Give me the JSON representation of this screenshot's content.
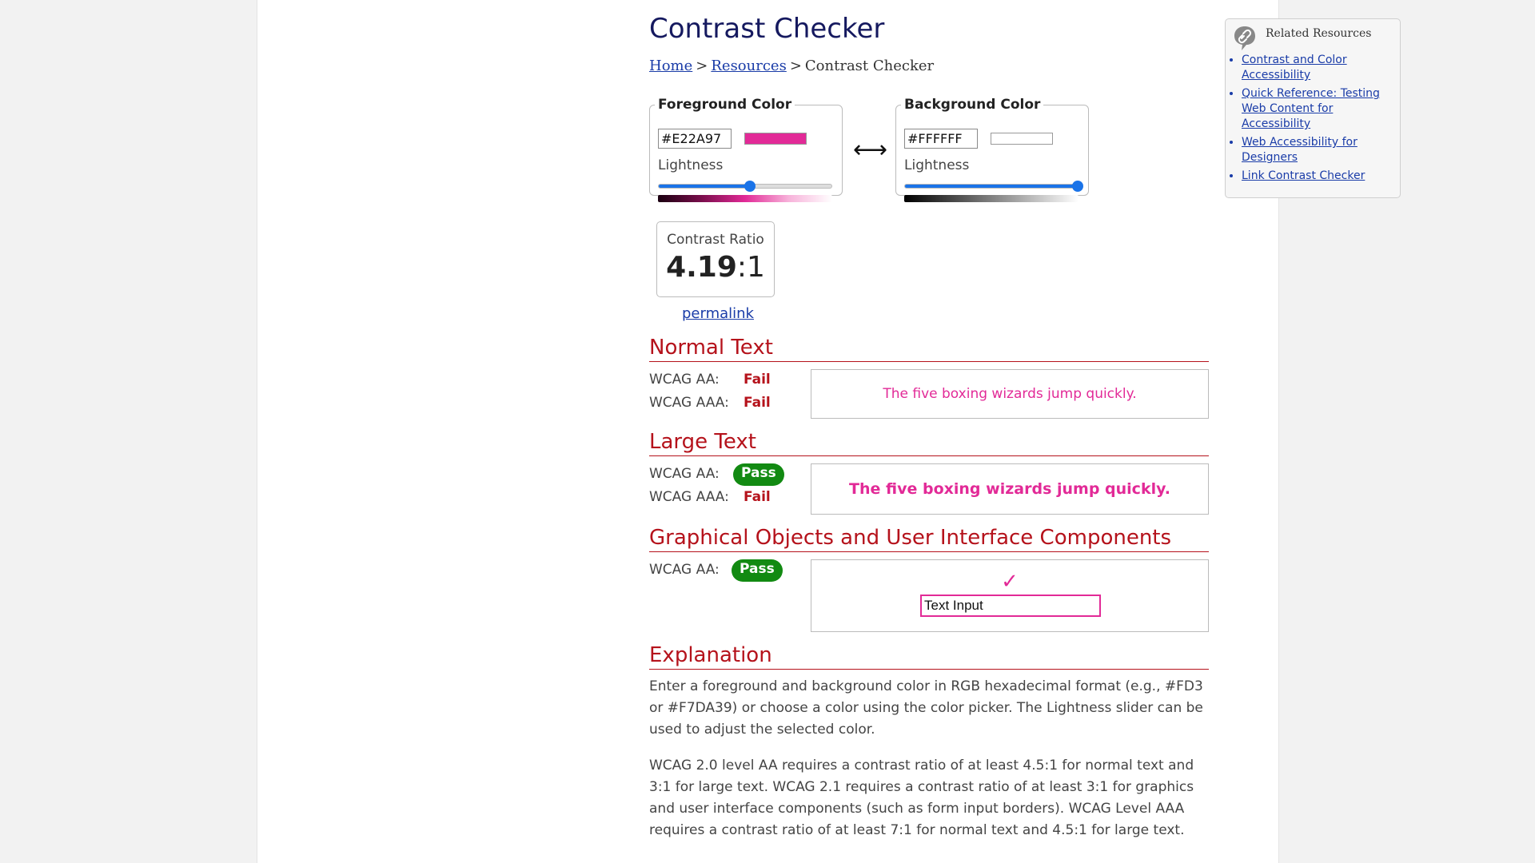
{
  "page_title": "Contrast Checker",
  "breadcrumb": {
    "home": "Home",
    "resources": "Resources",
    "current": "Contrast Checker",
    "separator": ">"
  },
  "foreground": {
    "legend": "Foreground Color",
    "hex": "#E22A97",
    "swatch_color": "#E22A97",
    "lightness_label": "Lightness",
    "lightness_value": 0.53,
    "gradient": "linear-gradient(to right, #1a0010, #7a0e4c, #e22a97, #f7b2da, #ffffff)"
  },
  "background": {
    "legend": "Background Color",
    "hex": "#FFFFFF",
    "swatch_color": "#FFFFFF",
    "lightness_label": "Lightness",
    "lightness_value": 1.0,
    "gradient": "linear-gradient(to right, #000000, #808080, #ffffff)"
  },
  "swap_symbol": "⟷",
  "contrast": {
    "label": "Contrast Ratio",
    "value": "4.19",
    "suffix": ":1",
    "permalink": "permalink"
  },
  "sections": {
    "normal_text": {
      "heading": "Normal Text",
      "aa_label": "WCAG AA:",
      "aa_result": "Fail",
      "aaa_label": "WCAG AAA:",
      "aaa_result": "Fail",
      "sample": "The five boxing wizards jump quickly."
    },
    "large_text": {
      "heading": "Large Text",
      "aa_label": "WCAG AA:",
      "aa_result": "Pass",
      "aaa_label": "WCAG AAA:",
      "aaa_result": "Fail",
      "sample": "The five boxing wizards jump quickly."
    },
    "graphical": {
      "heading": "Graphical Objects and User Interface Components",
      "aa_label": "WCAG AA:",
      "aa_result": "Pass",
      "checkmark": "✓",
      "input_value": "Text Input"
    },
    "explanation": {
      "heading": "Explanation",
      "p1": "Enter a foreground and background color in RGB hexadecimal format (e.g., #FD3 or #F7DA39) or choose a color using the color picker. The Lightness slider can be used to adjust the selected color.",
      "p2": "WCAG 2.0 level AA requires a contrast ratio of at least 4.5:1 for normal text and 3:1 for large text. WCAG 2.1 requires a contrast ratio of at least 3:1 for graphics and user interface components (such as form input borders). WCAG Level AAA requires a contrast ratio of at least 7:1 for normal text and 4.5:1 for large text."
    }
  },
  "related": {
    "title": "Related Resources",
    "icon": "link-bubble-icon",
    "links": [
      "Contrast and Color Accessibility",
      "Quick Reference: Testing Web Content for Accessibility",
      "Web Accessibility for Designers",
      "Link Contrast Checker"
    ]
  },
  "colors": {
    "heading": "#15195F",
    "accent_red": "#B5121B",
    "pass_green": "#128A12",
    "link": "#1A3CA8",
    "slider": "#1A73E8"
  }
}
